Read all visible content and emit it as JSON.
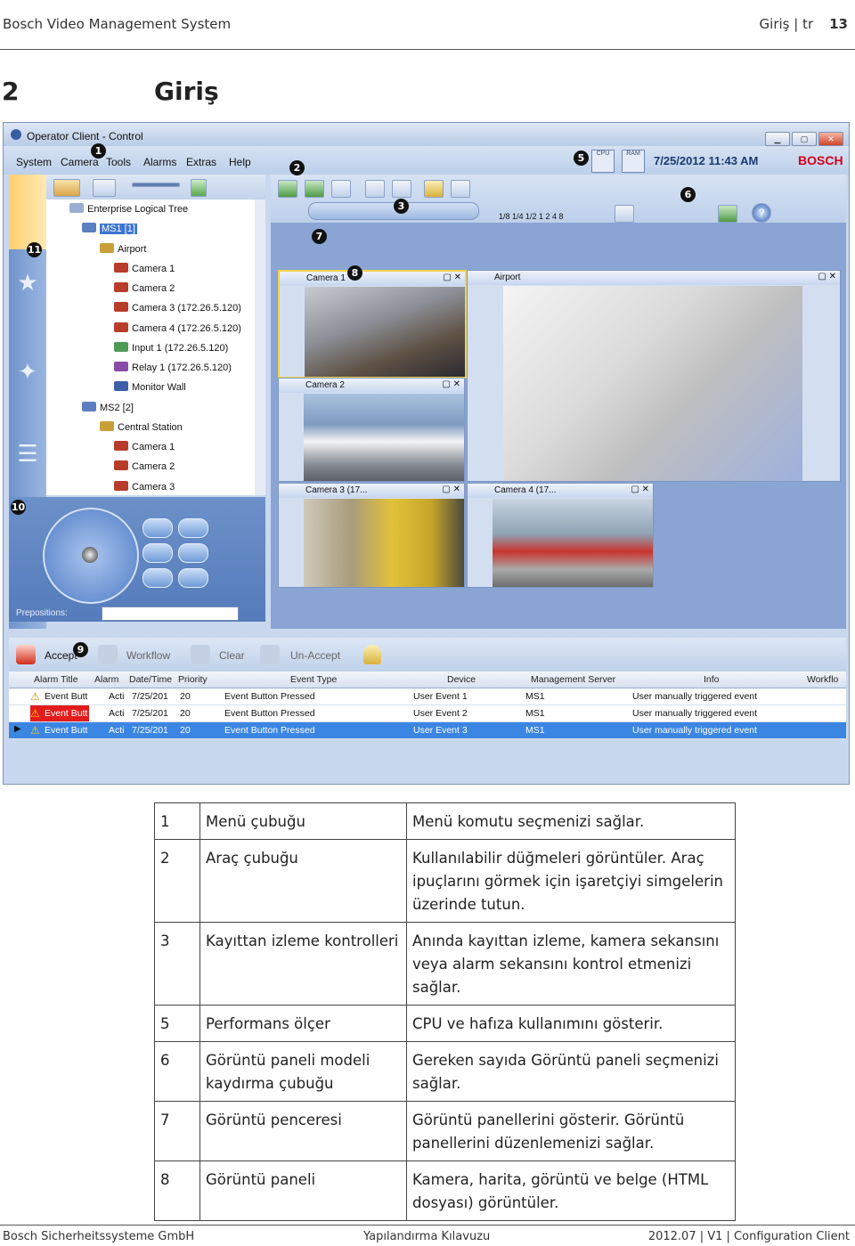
{
  "header": {
    "left": "Bosch Video Management System",
    "right": "Giriş | tr",
    "page": "13"
  },
  "section": {
    "number": "2",
    "title": "Giriş"
  },
  "screenshot": {
    "window_title": "Operator Client - Control",
    "menu": [
      "System",
      "Camera",
      "Tools",
      "Alarms",
      "Extras",
      "Help"
    ],
    "cpu_label": "CPU",
    "ram_label": "RAM",
    "datetime": "7/25/2012 11:43 AM",
    "brand": "BOSCH",
    "playback_speeds": "1/8 1/4 1/2  1   2   4   8",
    "tree": {
      "root": "Enterprise Logical Tree",
      "items": [
        "MS1 [1]",
        "Airport",
        "Camera 1",
        "Camera 2",
        "Camera 3 (172.26.5.120)",
        "Camera 4 (172.26.5.120)",
        "Input 1 (172.26.5.120)",
        "Relay 1 (172.26.5.120)",
        "Monitor Wall",
        "MS2 [2]",
        "Central Station",
        "Camera 1",
        "Camera 2",
        "Camera 3"
      ]
    },
    "prepositions_label": "Prepositions:",
    "panes": {
      "p1": "Camera 1",
      "p2": "Airport",
      "p3": "Camera 2",
      "p4": "Camera 3 (17...",
      "p5": "Camera 4 (17..."
    },
    "alarm_toolbar": [
      "Accept",
      "Workflow",
      "Clear",
      "Un-Accept"
    ],
    "alarm_columns": [
      "Alarm Title",
      "Alarm",
      "Date/Time",
      "Priority",
      "Event Type",
      "Device",
      "Management Server",
      "Info",
      "Workflo"
    ],
    "alarm_rows": [
      [
        "Event Butt",
        "Acti",
        "7/25/201",
        "20",
        "Event Button Pressed",
        "User Event 1",
        "MS1",
        "User manually triggered event"
      ],
      [
        "Event Butt",
        "Acti",
        "7/25/201",
        "20",
        "Event Button Pressed",
        "User Event 2",
        "MS1",
        "User manually triggered event"
      ],
      [
        "Event Butt",
        "Acti",
        "7/25/201",
        "20",
        "Event Button Pressed",
        "User Event 3",
        "MS1",
        "User manually triggered event"
      ]
    ],
    "callouts": [
      "1",
      "2",
      "3",
      "5",
      "6",
      "7",
      "8",
      "9",
      "10",
      "11"
    ]
  },
  "legend": [
    {
      "num": "1",
      "name": "Menü çubuğu",
      "desc": "Menü komutu seçmenizi sağlar."
    },
    {
      "num": "2",
      "name": "Araç çubuğu",
      "desc": "Kullanılabilir düğmeleri görüntüler. Araç ipuçlarını görmek için işaretçiyi simgelerin üzerinde tutun."
    },
    {
      "num": "3",
      "name": "Kayıttan izleme kontrolleri",
      "desc": "Anında kayıttan izleme, kamera sekansını veya alarm sekansını kontrol etmenizi sağlar."
    },
    {
      "num": "5",
      "name": "Performans ölçer",
      "desc": "CPU ve hafıza kullanımını gösterir."
    },
    {
      "num": "6",
      "name": "Görüntü paneli modeli kaydırma çubuğu",
      "desc": "Gereken sayıda Görüntü paneli seçmenizi sağlar."
    },
    {
      "num": "7",
      "name": "Görüntü penceresi",
      "desc": "Görüntü panellerini gösterir. Görüntü panellerini düzenlemenizi sağlar."
    },
    {
      "num": "8",
      "name": "Görüntü paneli",
      "desc": "Kamera, harita, görüntü ve belge (HTML dosyası) görüntüler."
    }
  ],
  "footer": {
    "left": "Bosch Sicherheitssysteme GmbH",
    "center": "Yapılandırma Kılavuzu",
    "right": "2012.07 | V1 | Configuration Client"
  }
}
